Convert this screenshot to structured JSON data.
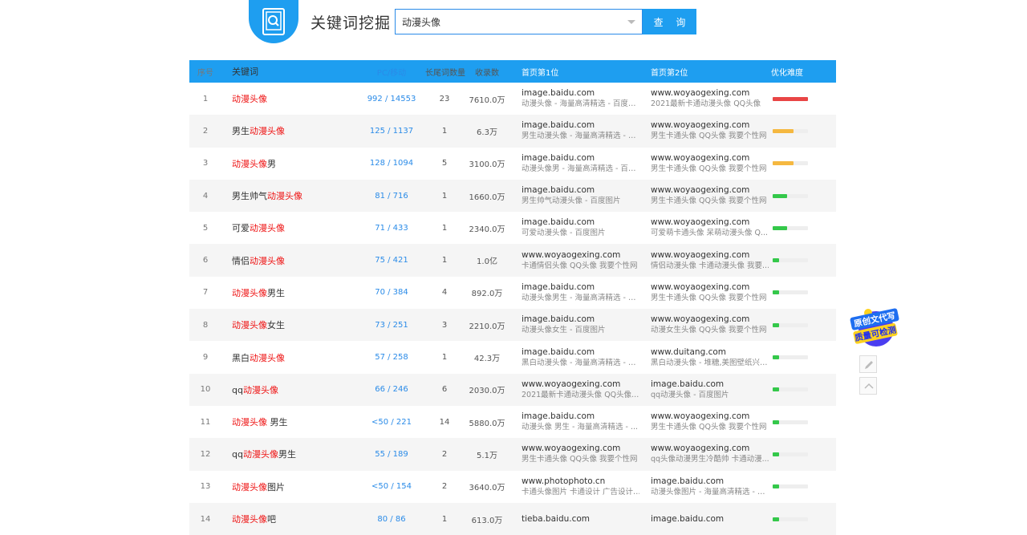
{
  "header": {
    "title": "关键词挖掘",
    "search_value": "动漫头像",
    "search_button": "查 询"
  },
  "table": {
    "columns": [
      "序号",
      "关键词",
      "PC/移动",
      "长尾词数量",
      "收录数",
      "首页第1位",
      "首页第2位",
      "优化难度"
    ],
    "rows": [
      {
        "idx": "1",
        "pre": "",
        "hl": "动漫头像",
        "post": "",
        "pc": "992 / 14553",
        "long": "23",
        "count": "7610.0万",
        "d1": "image.baidu.com",
        "t1": "动漫头像 - 海量高清精选 - 百度图片",
        "d2": "www.woyaogexing.com",
        "t2": "2021最新卡通动漫头像 QQ头像",
        "difficulty": 1.0,
        "color": "#e94545"
      },
      {
        "idx": "2",
        "pre": "男生",
        "hl": "动漫头像",
        "post": "",
        "pc": "125 / 1137",
        "long": "1",
        "count": "6.3万",
        "d1": "image.baidu.com",
        "t1": "男生动漫头像 - 海量高清精选 - 百...",
        "d2": "www.woyaogexing.com",
        "t2": "男生卡通头像 QQ头像 我要个性网",
        "difficulty": 0.6,
        "color": "#f5b840"
      },
      {
        "idx": "3",
        "pre": "",
        "hl": "动漫头像",
        "post": "男",
        "pc": "128 / 1094",
        "long": "5",
        "count": "3100.0万",
        "d1": "image.baidu.com",
        "t1": "动漫头像男 - 海量高清精选 - 百度...",
        "d2": "www.woyaogexing.com",
        "t2": "男生卡通头像 QQ头像 我要个性网",
        "difficulty": 0.6,
        "color": "#f5b840"
      },
      {
        "idx": "4",
        "pre": "男生帅气",
        "hl": "动漫头像",
        "post": "",
        "pc": "81 / 716",
        "long": "1",
        "count": "1660.0万",
        "d1": "image.baidu.com",
        "t1": "男生帅气动漫头像 - 百度图片",
        "d2": "www.woyaogexing.com",
        "t2": "男生卡通头像 QQ头像 我要个性网",
        "difficulty": 0.4,
        "color": "#34c84a"
      },
      {
        "idx": "5",
        "pre": "可爱",
        "hl": "动漫头像",
        "post": "",
        "pc": "71 / 433",
        "long": "1",
        "count": "2340.0万",
        "d1": "image.baidu.com",
        "t1": "可爱动漫头像 - 百度图片",
        "d2": "www.woyaogexing.com",
        "t2": "可爱萌卡通头像 呆萌动漫头像 Q...",
        "difficulty": 0.4,
        "color": "#34c84a"
      },
      {
        "idx": "6",
        "pre": "情侣",
        "hl": "动漫头像",
        "post": "",
        "pc": "75 / 421",
        "long": "1",
        "count": "1.0亿",
        "d1": "www.woyaogexing.com",
        "t1": "卡通情侣头像 QQ头像 我要个性网",
        "d2": "www.woyaogexing.com",
        "t2": "情侣动漫头像 卡通动漫头像 我要...",
        "difficulty": 0.18,
        "color": "#34c84a"
      },
      {
        "idx": "7",
        "pre": "",
        "hl": "动漫头像",
        "post": "男生",
        "pc": "70 / 384",
        "long": "4",
        "count": "892.0万",
        "d1": "image.baidu.com",
        "t1": "动漫头像男生 - 海量高清精选 - 百...",
        "d2": "www.woyaogexing.com",
        "t2": "男生卡通头像 QQ头像 我要个性网",
        "difficulty": 0.18,
        "color": "#34c84a"
      },
      {
        "idx": "8",
        "pre": "",
        "hl": "动漫头像",
        "post": "女生",
        "pc": "73 / 251",
        "long": "3",
        "count": "2210.0万",
        "d1": "image.baidu.com",
        "t1": "动漫头像女生 - 百度图片",
        "d2": "www.woyaogexing.com",
        "t2": "动漫女生头像 QQ头像 我要个性网",
        "difficulty": 0.18,
        "color": "#34c84a"
      },
      {
        "idx": "9",
        "pre": "黑白",
        "hl": "动漫头像",
        "post": "",
        "pc": "57 / 258",
        "long": "1",
        "count": "42.3万",
        "d1": "image.baidu.com",
        "t1": "黑白动漫头像 - 海量高清精选 - 百...",
        "d2": "www.duitang.com",
        "t2": "黑白动漫头像 - 堆糖,美图壁纸兴趣...",
        "difficulty": 0.18,
        "color": "#34c84a"
      },
      {
        "idx": "10",
        "pre": "qq",
        "hl": "动漫头像",
        "post": "",
        "pc": "66 / 246",
        "long": "6",
        "count": "2030.0万",
        "d1": "www.woyaogexing.com",
        "t1": "2021最新卡通动漫头像 QQ头像...",
        "d2": "image.baidu.com",
        "t2": "qq动漫头像 - 百度图片",
        "difficulty": 0.18,
        "color": "#34c84a"
      },
      {
        "idx": "11",
        "pre": "",
        "hl": "动漫头像",
        "post": " 男生",
        "pc": "<50 / 221",
        "long": "14",
        "count": "5880.0万",
        "d1": "image.baidu.com",
        "t1": "动漫头像 男生 - 海量高清精选 - ...",
        "d2": "www.woyaogexing.com",
        "t2": "男生卡通头像 QQ头像 我要个性网",
        "difficulty": 0.18,
        "color": "#34c84a"
      },
      {
        "idx": "12",
        "pre": "qq",
        "hl": "动漫头像",
        "post": "男生",
        "pc": "55 / 189",
        "long": "2",
        "count": "5.1万",
        "d1": "www.woyaogexing.com",
        "t1": "男生卡通头像 QQ头像 我要个性网",
        "d2": "www.woyaogexing.com",
        "t2": "qq头像动漫男生冷酷帅 卡通动漫...",
        "difficulty": 0.18,
        "color": "#34c84a"
      },
      {
        "idx": "13",
        "pre": "",
        "hl": "动漫头像",
        "post": "图片",
        "pc": "<50 / 154",
        "long": "2",
        "count": "3640.0万",
        "d1": "www.photophoto.cn",
        "t1": "卡通头像图片 卡通设计 广告设计-...",
        "d2": "image.baidu.com",
        "t2": "动漫头像图片 - 海量高清精选 - 百...",
        "difficulty": 0.18,
        "color": "#34c84a"
      },
      {
        "idx": "14",
        "pre": "",
        "hl": "动漫头像",
        "post": "吧",
        "pc": "80 / 86",
        "long": "1",
        "count": "613.0万",
        "d1": "tieba.baidu.com",
        "t1": "",
        "d2": "image.baidu.com",
        "t2": "",
        "difficulty": 0.18,
        "color": "#34c84a"
      }
    ]
  },
  "side": {
    "badge_line1": "原创文代写",
    "badge_line2": "质量可检测"
  }
}
